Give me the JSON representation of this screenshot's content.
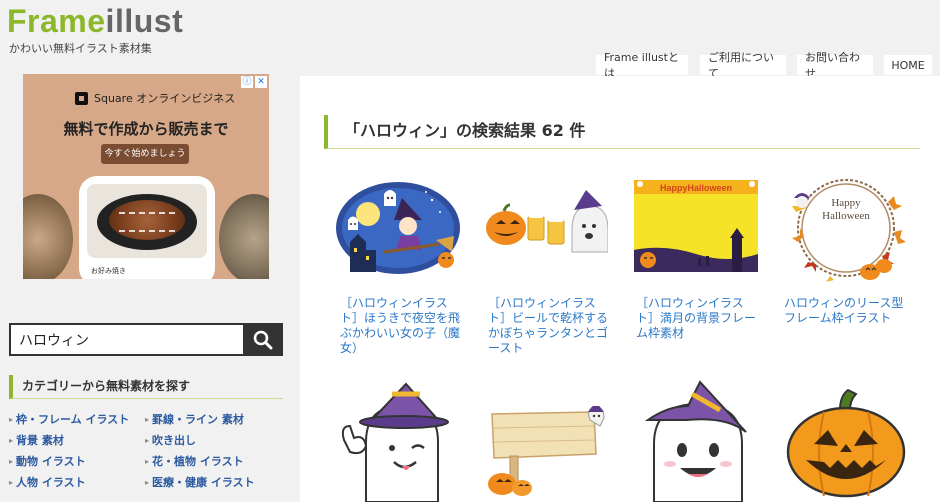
{
  "site": {
    "logo_part1": "Frame",
    "logo_part2": "illust",
    "tagline": "かわいい無料イラスト素材集"
  },
  "nav": [
    {
      "label": "Frame illustとは"
    },
    {
      "label": "ご利用について"
    },
    {
      "label": "お問い合わせ"
    },
    {
      "label": "HOME"
    }
  ],
  "ad": {
    "brand": "Square オンラインビジネス",
    "headline": "無料で作成から販売まで",
    "cta": "今すぐ始めましょう",
    "card_label": "お好み焼き",
    "adchoice_icons": [
      "info-icon",
      "close-icon"
    ]
  },
  "search": {
    "value": "ハロウィン",
    "icon": "search-icon"
  },
  "categories": {
    "title": "カテゴリーから無料素材を探す",
    "items": [
      {
        "label": "枠・フレーム イラスト"
      },
      {
        "label": "罫線・ライン 素材"
      },
      {
        "label": "背景 素材"
      },
      {
        "label": "吹き出し"
      },
      {
        "label": "動物 イラスト"
      },
      {
        "label": "花・植物 イラスト"
      },
      {
        "label": "人物 イラスト"
      },
      {
        "label": "医療・健康 イラスト"
      }
    ]
  },
  "results": {
    "heading": "「ハロウィン」の検索結果 62 件",
    "items": [
      {
        "title": "［ハロウィンイラスト］ほうきで夜空を飛ぶかわいい女の子（魔女）"
      },
      {
        "title": "［ハロウィンイラスト］ビールで乾杯するかぼちゃランタンとゴースト"
      },
      {
        "title": "［ハロウィンイラスト］満月の背景フレーム枠素材"
      },
      {
        "title": "ハロウィンのリース型フレーム枠イラスト"
      }
    ],
    "thumb_texts": {
      "banner": "HappyHalloween",
      "wreath_line1": "Happy",
      "wreath_line2": "Halloween"
    }
  },
  "colors": {
    "brand_green": "#8ab82a",
    "link_blue": "#2b78c8",
    "category_blue": "#2b5aa0"
  }
}
